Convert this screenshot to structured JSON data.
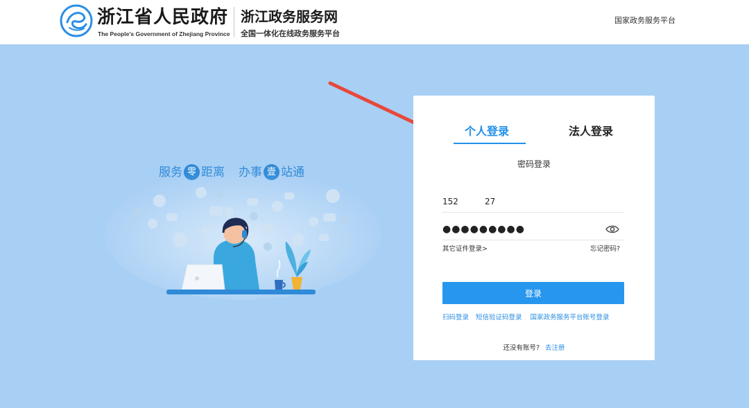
{
  "header": {
    "gov_title": "浙江省人民政府",
    "gov_subtitle": "The People's Government of Zhejiang Province",
    "site_title": "浙江政务服务网",
    "site_subtitle": "全国一体化在线政务服务平台",
    "nation_link": "国家政务服务平台"
  },
  "promo": {
    "slogan_part1": "服务",
    "slogan_circle1": "零",
    "slogan_part2": "距离",
    "slogan_part3": "办事",
    "slogan_circle2": "壹",
    "slogan_part4": "站通"
  },
  "login": {
    "tab_personal": "个人登录",
    "tab_legal": "法人登录",
    "method_title": "密码登录",
    "account_value": "152          27",
    "password_value": "●●●●●●●●●",
    "other_id_link": "其它证件登录>",
    "forgot_link": "忘记密码?",
    "submit_label": "登录",
    "alt_scan": "扫码登录",
    "alt_sms": "短信验证码登录",
    "alt_national": "国家政务服务平台账号登录",
    "no_account": "还没有账号?",
    "register_link": "去注册"
  },
  "colors": {
    "background": "#a8cff4",
    "accent": "#2190e8",
    "button": "#2796ee",
    "arrow": "#e8483c"
  }
}
